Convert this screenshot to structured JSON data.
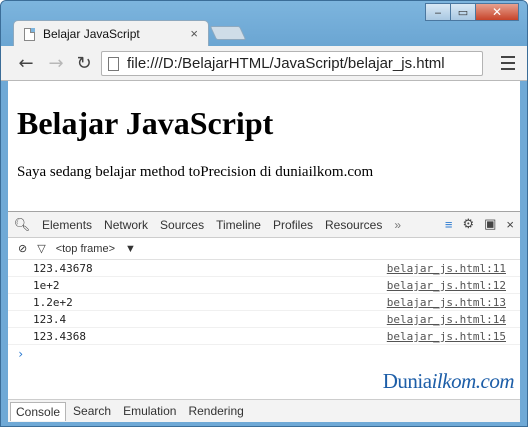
{
  "browser": {
    "tab_title": "Belajar JavaScript",
    "tab_close": "×",
    "address": "file:///D:/BelajarHTML/JavaScript/belajar_js.html",
    "window_buttons": {
      "minimize": "‒",
      "maximize": "▭",
      "close": "✕"
    },
    "nav": {
      "back": "←",
      "forward": "→",
      "reload": "↻"
    }
  },
  "page": {
    "heading": "Belajar JavaScript",
    "paragraph": "Saya sedang belajar method toPrecision di duniailkom.com"
  },
  "devtools": {
    "tabs": [
      "Elements",
      "Network",
      "Sources",
      "Timeline",
      "Profiles",
      "Resources"
    ],
    "more": "»",
    "close": "×",
    "frame_select": "<top frame>",
    "frame_arrow": "▼",
    "console_rows": [
      {
        "value": "123.43678",
        "source": "belajar_js.html:11"
      },
      {
        "value": "1e+2",
        "source": "belajar_js.html:12"
      },
      {
        "value": "1.2e+2",
        "source": "belajar_js.html:13"
      },
      {
        "value": "123.4",
        "source": "belajar_js.html:14"
      },
      {
        "value": "123.4368",
        "source": "belajar_js.html:15"
      }
    ],
    "prompt": "›",
    "drawer_tabs": [
      "Console",
      "Search",
      "Emulation",
      "Rendering"
    ]
  },
  "watermark": {
    "part1": "Dunia",
    "part2": "ilkom.com"
  }
}
